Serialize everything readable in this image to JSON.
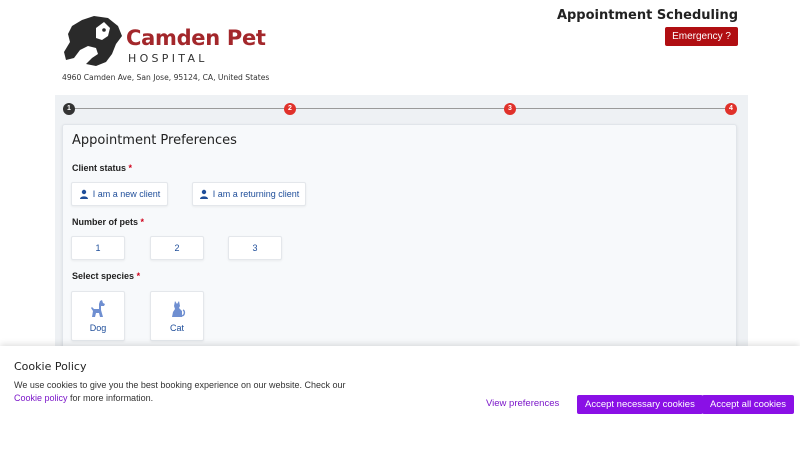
{
  "header": {
    "brand_name": "Camden Pet",
    "brand_sub": "HOSPITAL",
    "address": "4960 Camden Ave, San Jose, 95124, CA, United States",
    "app_title": "Appointment Scheduling",
    "emergency_label": "Emergency ?"
  },
  "steps": [
    "1",
    "2",
    "3",
    "4"
  ],
  "form": {
    "title": "Appointment Preferences",
    "client_status": {
      "label": "Client status",
      "required_mark": "*",
      "options": [
        "I am a new client",
        "I am a returning client"
      ]
    },
    "pets": {
      "label": "Number of pets",
      "required_mark": "*",
      "options": [
        "1",
        "2",
        "3"
      ]
    },
    "species": {
      "label": "Select species",
      "required_mark": "*",
      "options": [
        "Dog",
        "Cat"
      ]
    }
  },
  "cookie": {
    "title": "Cookie Policy",
    "text_line1": "We use cookies to give you the best booking experience on our website. Check our",
    "link": "Cookie policy",
    "text_line2": "for more information.",
    "view_preferences": "View preferences",
    "accept_necessary": "Accept necessary cookies",
    "accept_all": "Accept all cookies"
  },
  "colors": {
    "brand_red": "#a3272b",
    "emergency": "#b00e12",
    "step_active": "#333333",
    "step_pending": "#e0312a",
    "option_text": "#1f4e9a",
    "cookie_accent": "#8a10e6"
  },
  "icons": {
    "logo": "dog-cat-silhouette-icon",
    "client": "user-icon",
    "dog": "dog-icon",
    "cat": "cat-icon"
  }
}
